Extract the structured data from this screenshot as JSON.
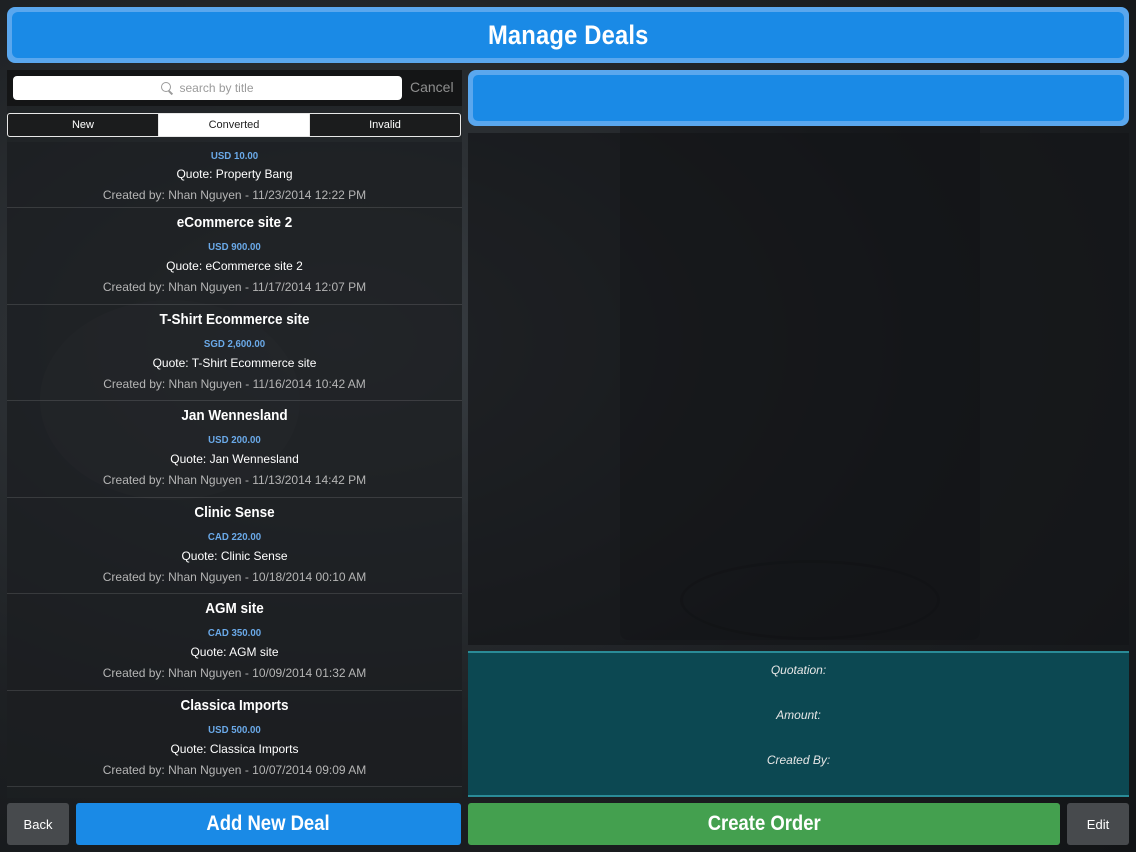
{
  "header": {
    "title": "Manage Deals"
  },
  "search": {
    "placeholder": "search by title",
    "cancel_label": "Cancel"
  },
  "tabs": [
    {
      "label": "New",
      "active": false
    },
    {
      "label": "Converted",
      "active": true
    },
    {
      "label": "Invalid",
      "active": false
    }
  ],
  "deals": [
    {
      "title": "",
      "amount": "USD 10.00",
      "quote": "Quote: Property Bang",
      "created": "Created by: Nhan Nguyen - 11/23/2014 12:22 PM"
    },
    {
      "title": "eCommerce site 2",
      "amount": "USD 900.00",
      "quote": "Quote: eCommerce site 2",
      "created": "Created by: Nhan Nguyen - 11/17/2014 12:07 PM"
    },
    {
      "title": "T-Shirt Ecommerce site",
      "amount": "SGD 2,600.00",
      "quote": "Quote: T-Shirt Ecommerce site",
      "created": "Created by: Nhan Nguyen - 11/16/2014 10:42 AM"
    },
    {
      "title": "Jan Wennesland",
      "amount": "USD 200.00",
      "quote": "Quote: Jan Wennesland",
      "created": "Created by: Nhan Nguyen - 11/13/2014 14:42 PM"
    },
    {
      "title": "Clinic Sense",
      "amount": "CAD 220.00",
      "quote": "Quote: Clinic Sense",
      "created": "Created by: Nhan Nguyen - 10/18/2014 00:10 AM"
    },
    {
      "title": "AGM site",
      "amount": "CAD 350.00",
      "quote": "Quote: AGM site",
      "created": "Created by: Nhan Nguyen - 10/09/2014 01:32 AM"
    },
    {
      "title": "Classica Imports",
      "amount": "USD 500.00",
      "quote": "Quote: Classica Imports",
      "created": "Created by: Nhan Nguyen - 10/07/2014 09:09 AM"
    }
  ],
  "details": {
    "quotation_label": "Quotation:",
    "amount_label": "Amount:",
    "created_by_label": "Created By:"
  },
  "buttons": {
    "back": "Back",
    "add_new_deal": "Add New Deal",
    "create_order": "Create Order",
    "edit": "Edit"
  },
  "colors": {
    "accent_blue": "#1a8ae6",
    "header_border": "#5aa7ee",
    "amount_blue": "#6aa9e8",
    "create_green": "#44a04f",
    "info_teal": "#0c4852"
  }
}
